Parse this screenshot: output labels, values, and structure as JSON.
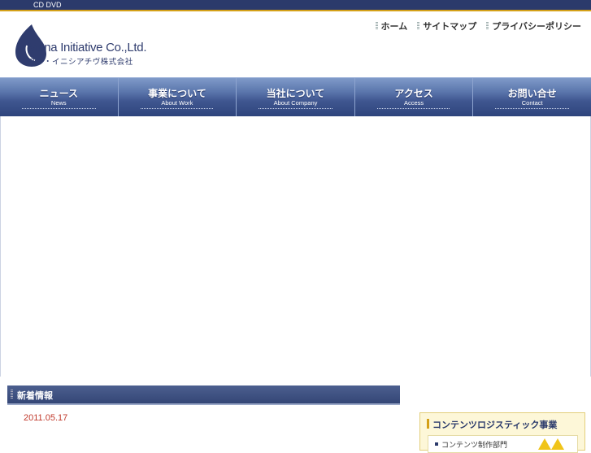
{
  "topbar": {
    "text": "CD DVD"
  },
  "logo": {
    "main": "Mana Initiative Co.,Ltd.",
    "sub": "マナ・イニシアチヴ株式会社"
  },
  "util_nav": [
    {
      "label": "ホーム"
    },
    {
      "label": "サイトマップ"
    },
    {
      "label": "プライバシーポリシー"
    }
  ],
  "global_nav": [
    {
      "jp": "ニュース",
      "en": "News"
    },
    {
      "jp": "事業について",
      "en": "About Work"
    },
    {
      "jp": "当社について",
      "en": "About Company"
    },
    {
      "jp": "アクセス",
      "en": "Access"
    },
    {
      "jp": "お問い合せ",
      "en": "Contact"
    }
  ],
  "news": {
    "title": "新着情報",
    "date": "2011.05.17"
  },
  "sidebar": {
    "title": "コンテンツロジスティック事業",
    "item": "コンテンツ制作部門"
  },
  "colors": {
    "navy": "#2b3a6b",
    "gold": "#d4a017",
    "date_red": "#c0392b"
  }
}
